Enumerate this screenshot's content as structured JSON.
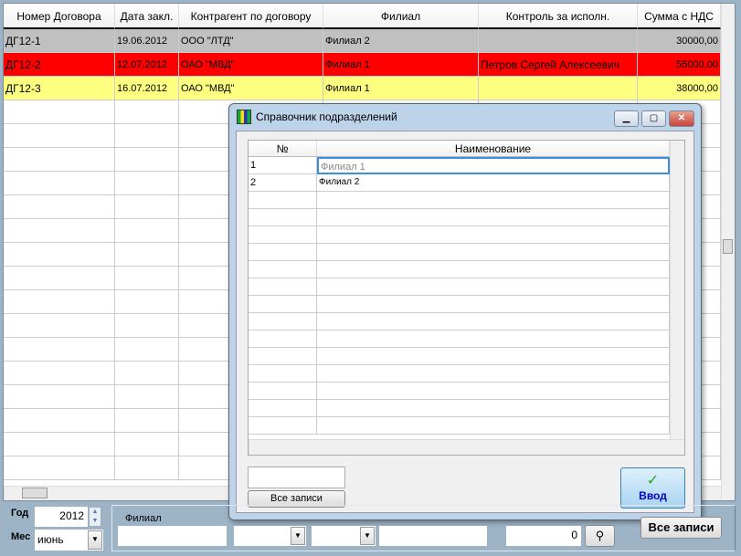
{
  "grid": {
    "columns": [
      "Номер Договора",
      "Дата закл.",
      "Контрагент по договору",
      "Филиал",
      "Контроль за исполн.",
      "Сумма с НДС"
    ],
    "rows": [
      {
        "cells": [
          "ДГ12-1",
          "19.06.2012",
          "ООО \"ЛТД\"",
          "Филиал 2",
          "",
          "30000,00"
        ],
        "color": "#c0c0c0"
      },
      {
        "cells": [
          "ДГ12-2",
          "12.07.2012",
          "ОАО \"МВД\"",
          "Филиал 1",
          "Петров Сергей Алексеевич",
          "55000,00"
        ],
        "color": "#ff0000"
      },
      {
        "cells": [
          "ДГ12-3",
          "16.07.2012",
          "ОАО \"МВД\"",
          "Филиал 1",
          "",
          "38000,00"
        ],
        "color": "#ffff80"
      }
    ]
  },
  "dialog": {
    "title": "Справочник подразделений",
    "columns": [
      "№",
      "Наименование"
    ],
    "rows": [
      [
        "1",
        "Филиал 1"
      ],
      [
        "2",
        "Филиал 2"
      ]
    ],
    "all_records_label": "Все записи",
    "enter_label": "Ввод",
    "search_value": ""
  },
  "filters": {
    "year_label": "Год",
    "year_value": "2012",
    "month_label": "Мес",
    "month_value": "июнь",
    "branch_label": "Филиал",
    "branch_value": "",
    "count_value": "0",
    "all_records_label": "Все записи"
  }
}
